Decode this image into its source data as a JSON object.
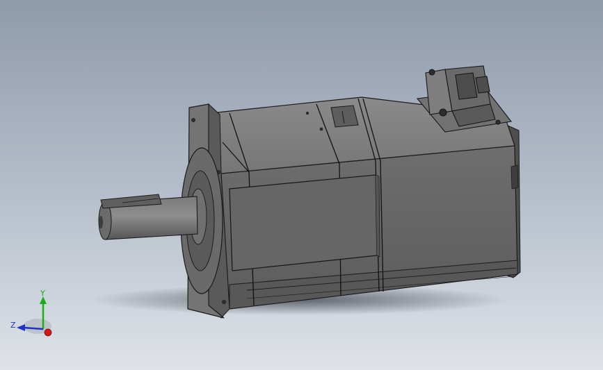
{
  "viewport": {
    "background_top": "#8f9aab",
    "background_bottom": "#dfe3e8"
  },
  "model": {
    "body_color": "#6d6d6d",
    "body_dark": "#4a4a4a",
    "body_light": "#8a8a8a",
    "edge_color": "#1a1a1a"
  },
  "triad": {
    "x_color": "#d01818",
    "y_color": "#16b016",
    "z_color": "#2030c8",
    "y_label": "Y",
    "z_label": "Z",
    "origin_icon": "axis-origin-sphere"
  }
}
